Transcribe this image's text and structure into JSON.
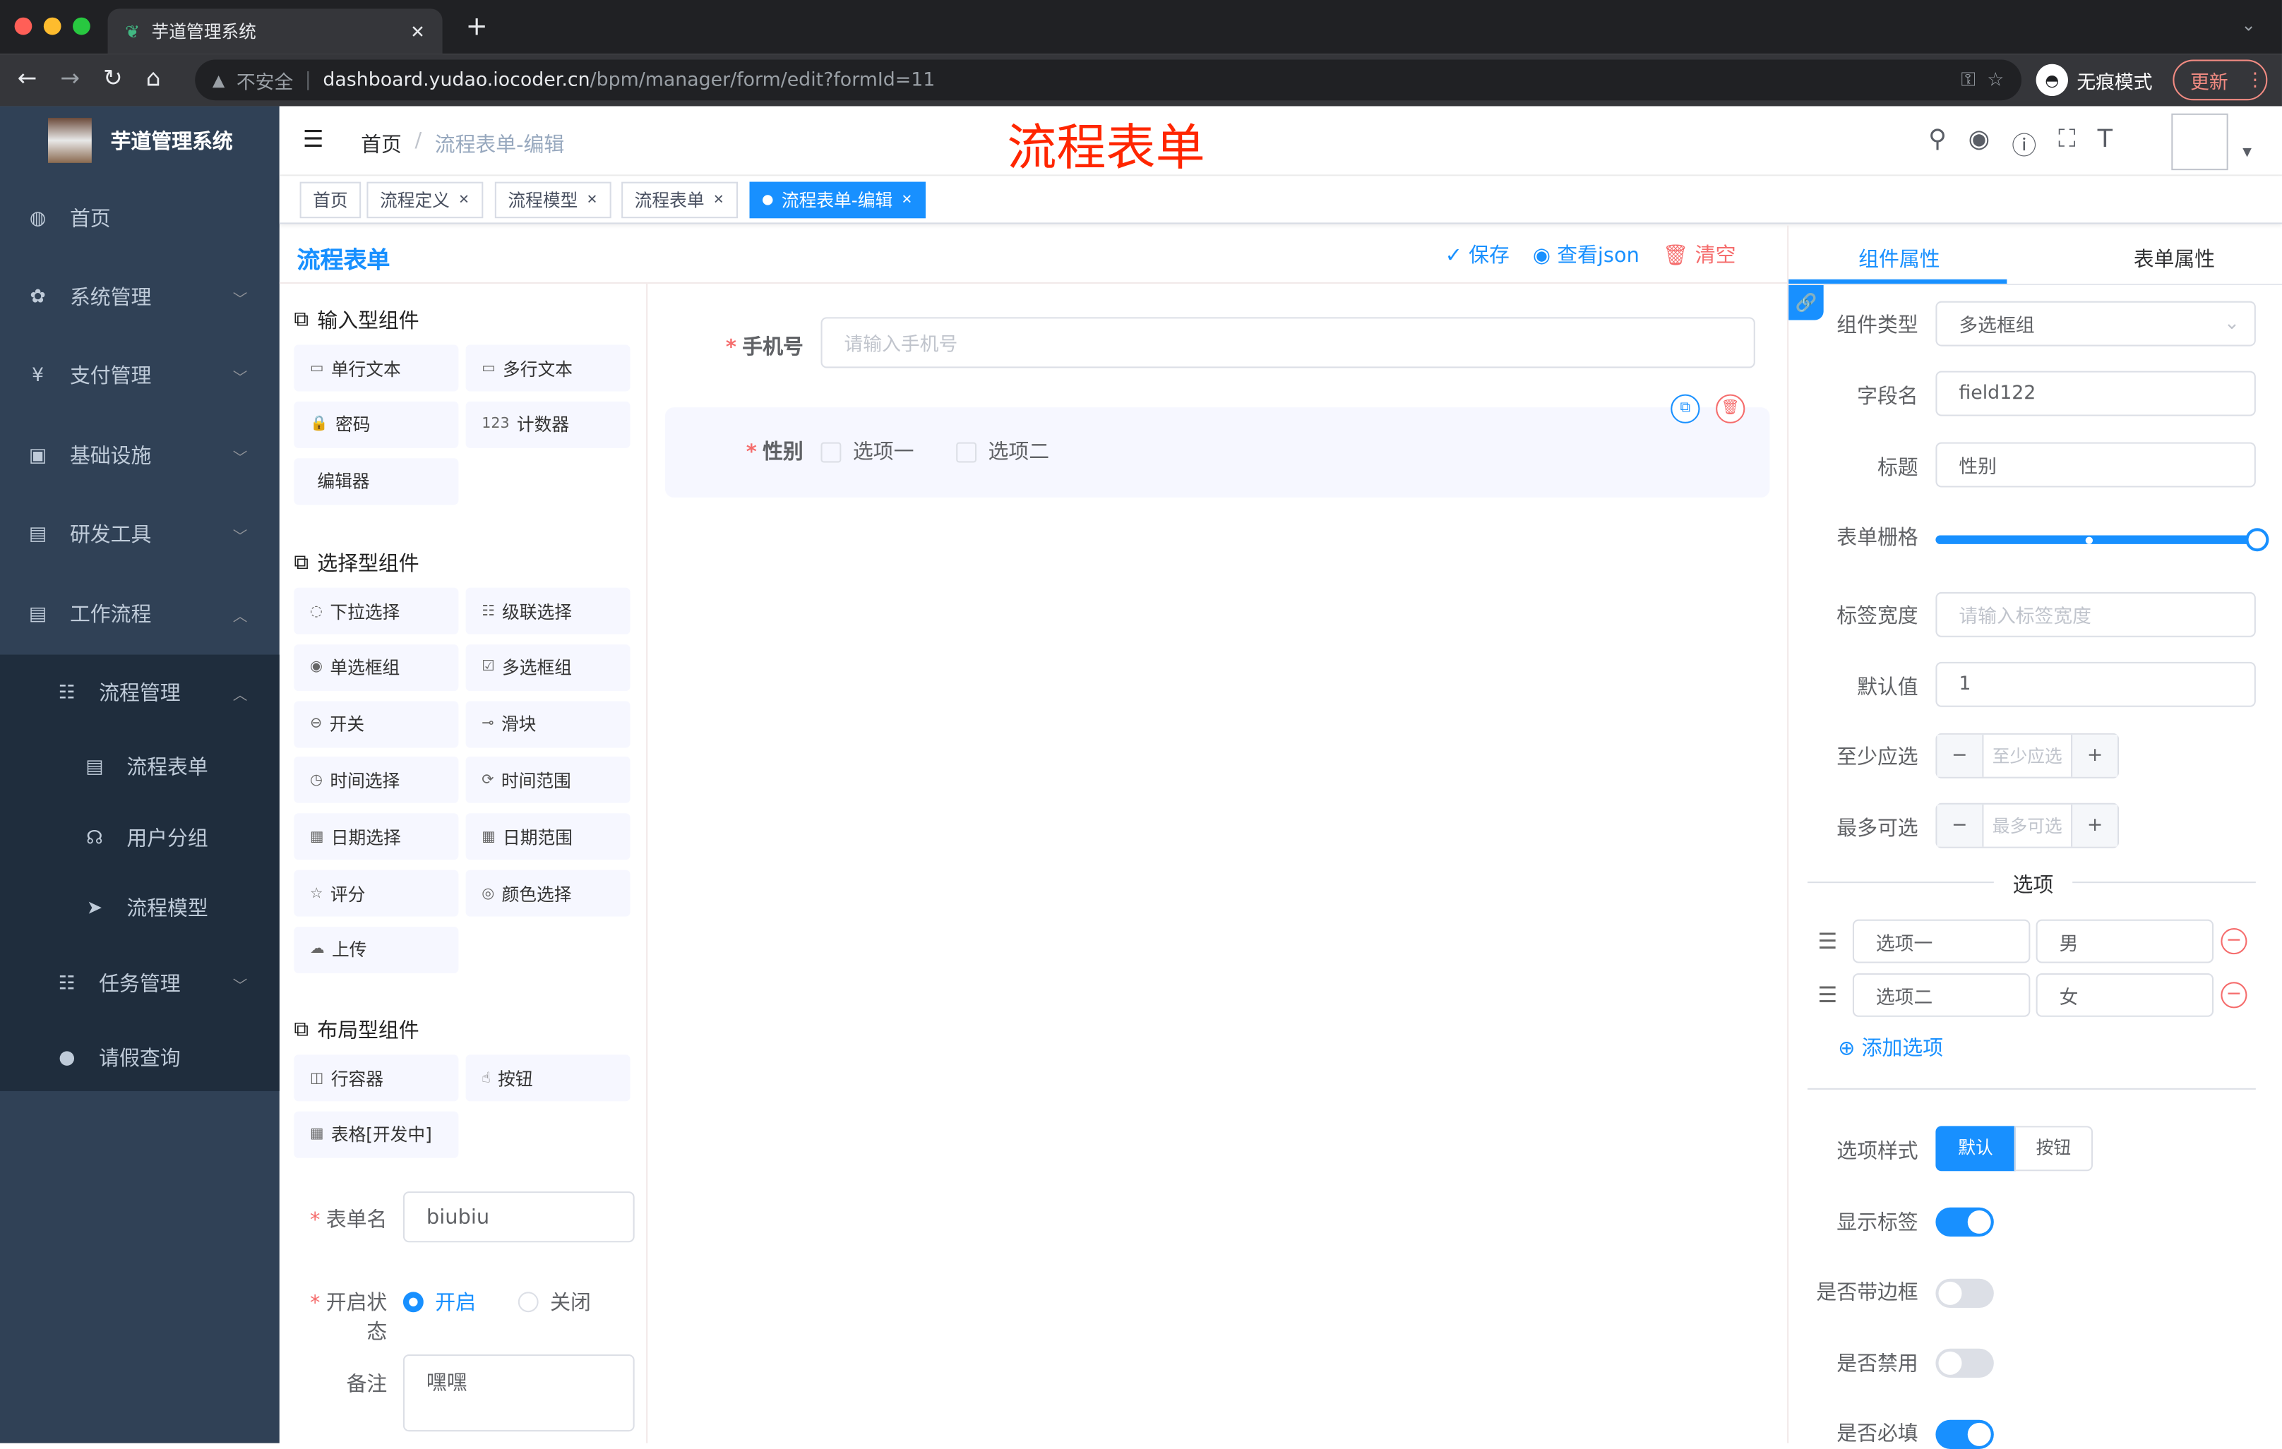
{
  "browser": {
    "tab_title": "芋道管理系统",
    "url_host": "dashboard.yudao.iocoder.cn",
    "url_path": "/bpm/manager/form/edit?formId=11",
    "insecure_label": "不安全",
    "incognito_label": "无痕模式",
    "update_label": "更新"
  },
  "sidebar": {
    "title": "芋道管理系统",
    "items": [
      {
        "label": "首页",
        "icon": "dashboard-icon"
      },
      {
        "label": "系统管理",
        "icon": "gear-icon"
      },
      {
        "label": "支付管理",
        "icon": "yen-icon"
      },
      {
        "label": "基础设施",
        "icon": "monitor-icon"
      },
      {
        "label": "研发工具",
        "icon": "toolbox-icon"
      },
      {
        "label": "工作流程",
        "icon": "toolbox-icon"
      },
      {
        "label": "流程管理",
        "icon": "tree-icon"
      },
      {
        "label": "流程表单",
        "icon": "form-icon"
      },
      {
        "label": "用户分组",
        "icon": "group-icon"
      },
      {
        "label": "流程模型",
        "icon": "send-icon"
      },
      {
        "label": "任务管理",
        "icon": "tree-icon"
      },
      {
        "label": "请假查询",
        "icon": "user-icon"
      }
    ]
  },
  "header": {
    "breadcrumb": [
      "首页",
      "流程表单-编辑"
    ],
    "page_heading": "流程表单"
  },
  "tags": [
    {
      "label": "首页"
    },
    {
      "label": "流程定义"
    },
    {
      "label": "流程模型"
    },
    {
      "label": "流程表单"
    },
    {
      "label": "流程表单-编辑",
      "active": true
    }
  ],
  "left": {
    "logo_title": "流程表单",
    "groups": [
      {
        "title": "输入型组件",
        "items": [
          "单行文本",
          "多行文本",
          "密码",
          "计数器",
          "编辑器"
        ]
      },
      {
        "title": "选择型组件",
        "items": [
          "下拉选择",
          "级联选择",
          "单选框组",
          "多选框组",
          "开关",
          "滑块",
          "时间选择",
          "时间范围",
          "日期选择",
          "日期范围",
          "评分",
          "颜色选择",
          "上传"
        ]
      },
      {
        "title": "布局型组件",
        "items": [
          "行容器",
          "按钮",
          "表格[开发中]"
        ]
      }
    ],
    "form_name_label": "表单名",
    "form_name": "biubiu",
    "status_label": "开启状态",
    "status_on": "开启",
    "status_off": "关闭",
    "status_value": "开启",
    "remark_label": "备注",
    "remark": "嘿嘿"
  },
  "center": {
    "actions": {
      "save": "保存",
      "view_json": "查看json",
      "clear": "清空"
    },
    "phone_label": "手机号",
    "phone_placeholder": "请输入手机号",
    "gender_label": "性别",
    "options": [
      "选项一",
      "选项二"
    ]
  },
  "right": {
    "tabs": [
      "组件属性",
      "表单属性"
    ],
    "active_tab": "组件属性",
    "component_type_label": "组件类型",
    "component_type": "多选框组",
    "field_label": "字段名",
    "field": "field122",
    "title_label": "标题",
    "title": "性别",
    "grid_label": "表单栅格",
    "grid_value": 24,
    "label_width_label": "标签宽度",
    "label_width_placeholder": "请输入标签宽度",
    "default_label": "默认值",
    "default": "1",
    "min_label": "至少应选",
    "min_placeholder": "至少应选",
    "max_label": "最多可选",
    "max_placeholder": "最多可选",
    "options_divider": "选项",
    "options": [
      {
        "label": "选项一",
        "value": "男"
      },
      {
        "label": "选项二",
        "value": "女"
      }
    ],
    "add_option": "添加选项",
    "style_label": "选项样式",
    "style_buttons": [
      "默认",
      "按钮"
    ],
    "style_value": "默认",
    "show_label_label": "显示标签",
    "show_label": true,
    "border_label": "是否带边框",
    "border": false,
    "disabled_label": "是否禁用",
    "disabled": false,
    "required_label": "是否必填",
    "required": true
  },
  "colors": {
    "primary": "#1890ff",
    "sidebar": "#304156",
    "heading_red": "#ff2600",
    "danger": "#f56c6c"
  }
}
